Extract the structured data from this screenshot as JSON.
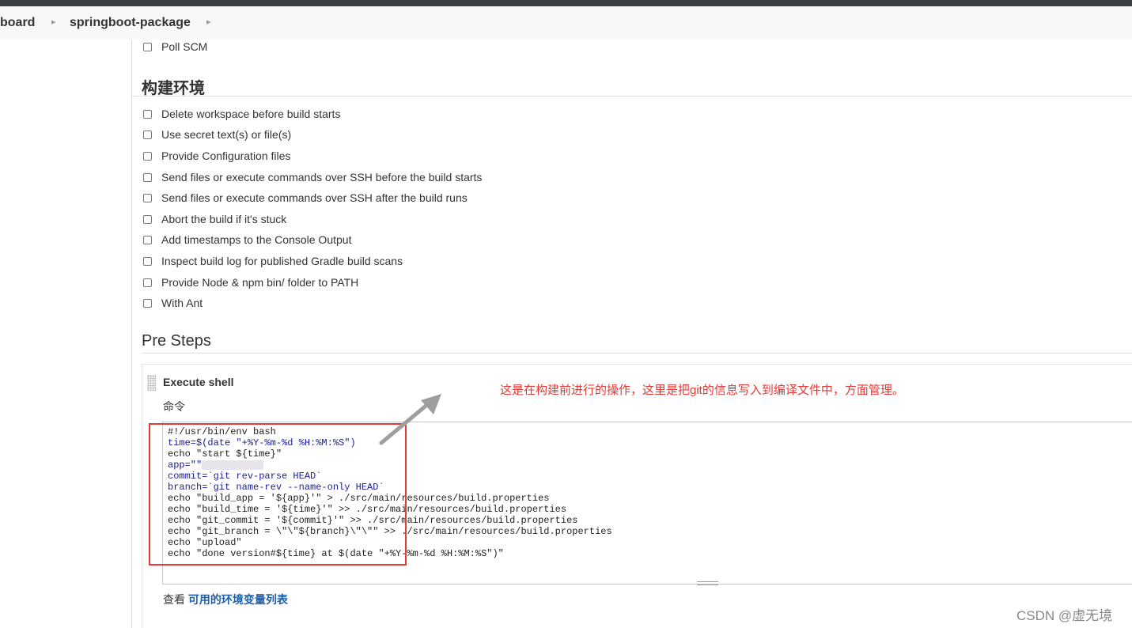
{
  "breadcrumb": {
    "items": [
      "board",
      "springboot-package"
    ]
  },
  "triggers": {
    "poll_scm": "Poll SCM"
  },
  "build_env": {
    "heading": "构建环境",
    "options": [
      "Delete workspace before build starts",
      "Use secret text(s) or file(s)",
      "Provide Configuration files",
      "Send files or execute commands over SSH before the build starts",
      "Send files or execute commands over SSH after the build runs",
      "Abort the build if it's stuck",
      "Add timestamps to the Console Output",
      "Inspect build log for published Gradle build scans",
      "Provide Node & npm bin/ folder to PATH",
      "With Ant"
    ]
  },
  "pre_steps": {
    "heading": "Pre Steps",
    "step_title": "Execute shell",
    "command_label": "命令",
    "code_lines": [
      "#!/usr/bin/env bash",
      "time=$(date \"+%Y-%m-%d %H:%M:%S\")",
      "echo \"start ${time}\"",
      "app=\"\"",
      "commit=`git rev-parse HEAD`",
      "branch=`git name-rev --name-only HEAD`",
      "echo \"build_app = '${app}'\" > ./src/main/resources/build.properties",
      "echo \"build_time = '${time}'\" >> ./src/main/resources/build.properties",
      "echo \"git_commit = '${commit}'\" >> ./src/main/resources/build.properties",
      "echo \"git_branch = \\\"\\\"${branch}\\\"\\\"\" >> ./src/main/resources/build.properties",
      "echo \"upload\"",
      "echo \"done version#${time} at $(date \"+%Y-%m-%d %H:%M:%S\")\""
    ],
    "footer_prefix": "查看",
    "footer_link": "可用的环境变量列表"
  },
  "annotation": {
    "note": "这是在构建前进行的操作，这里是把git的信息写入到编译文件中，方面管理。",
    "color": "#e53935"
  },
  "watermark": "CSDN @虚无境"
}
